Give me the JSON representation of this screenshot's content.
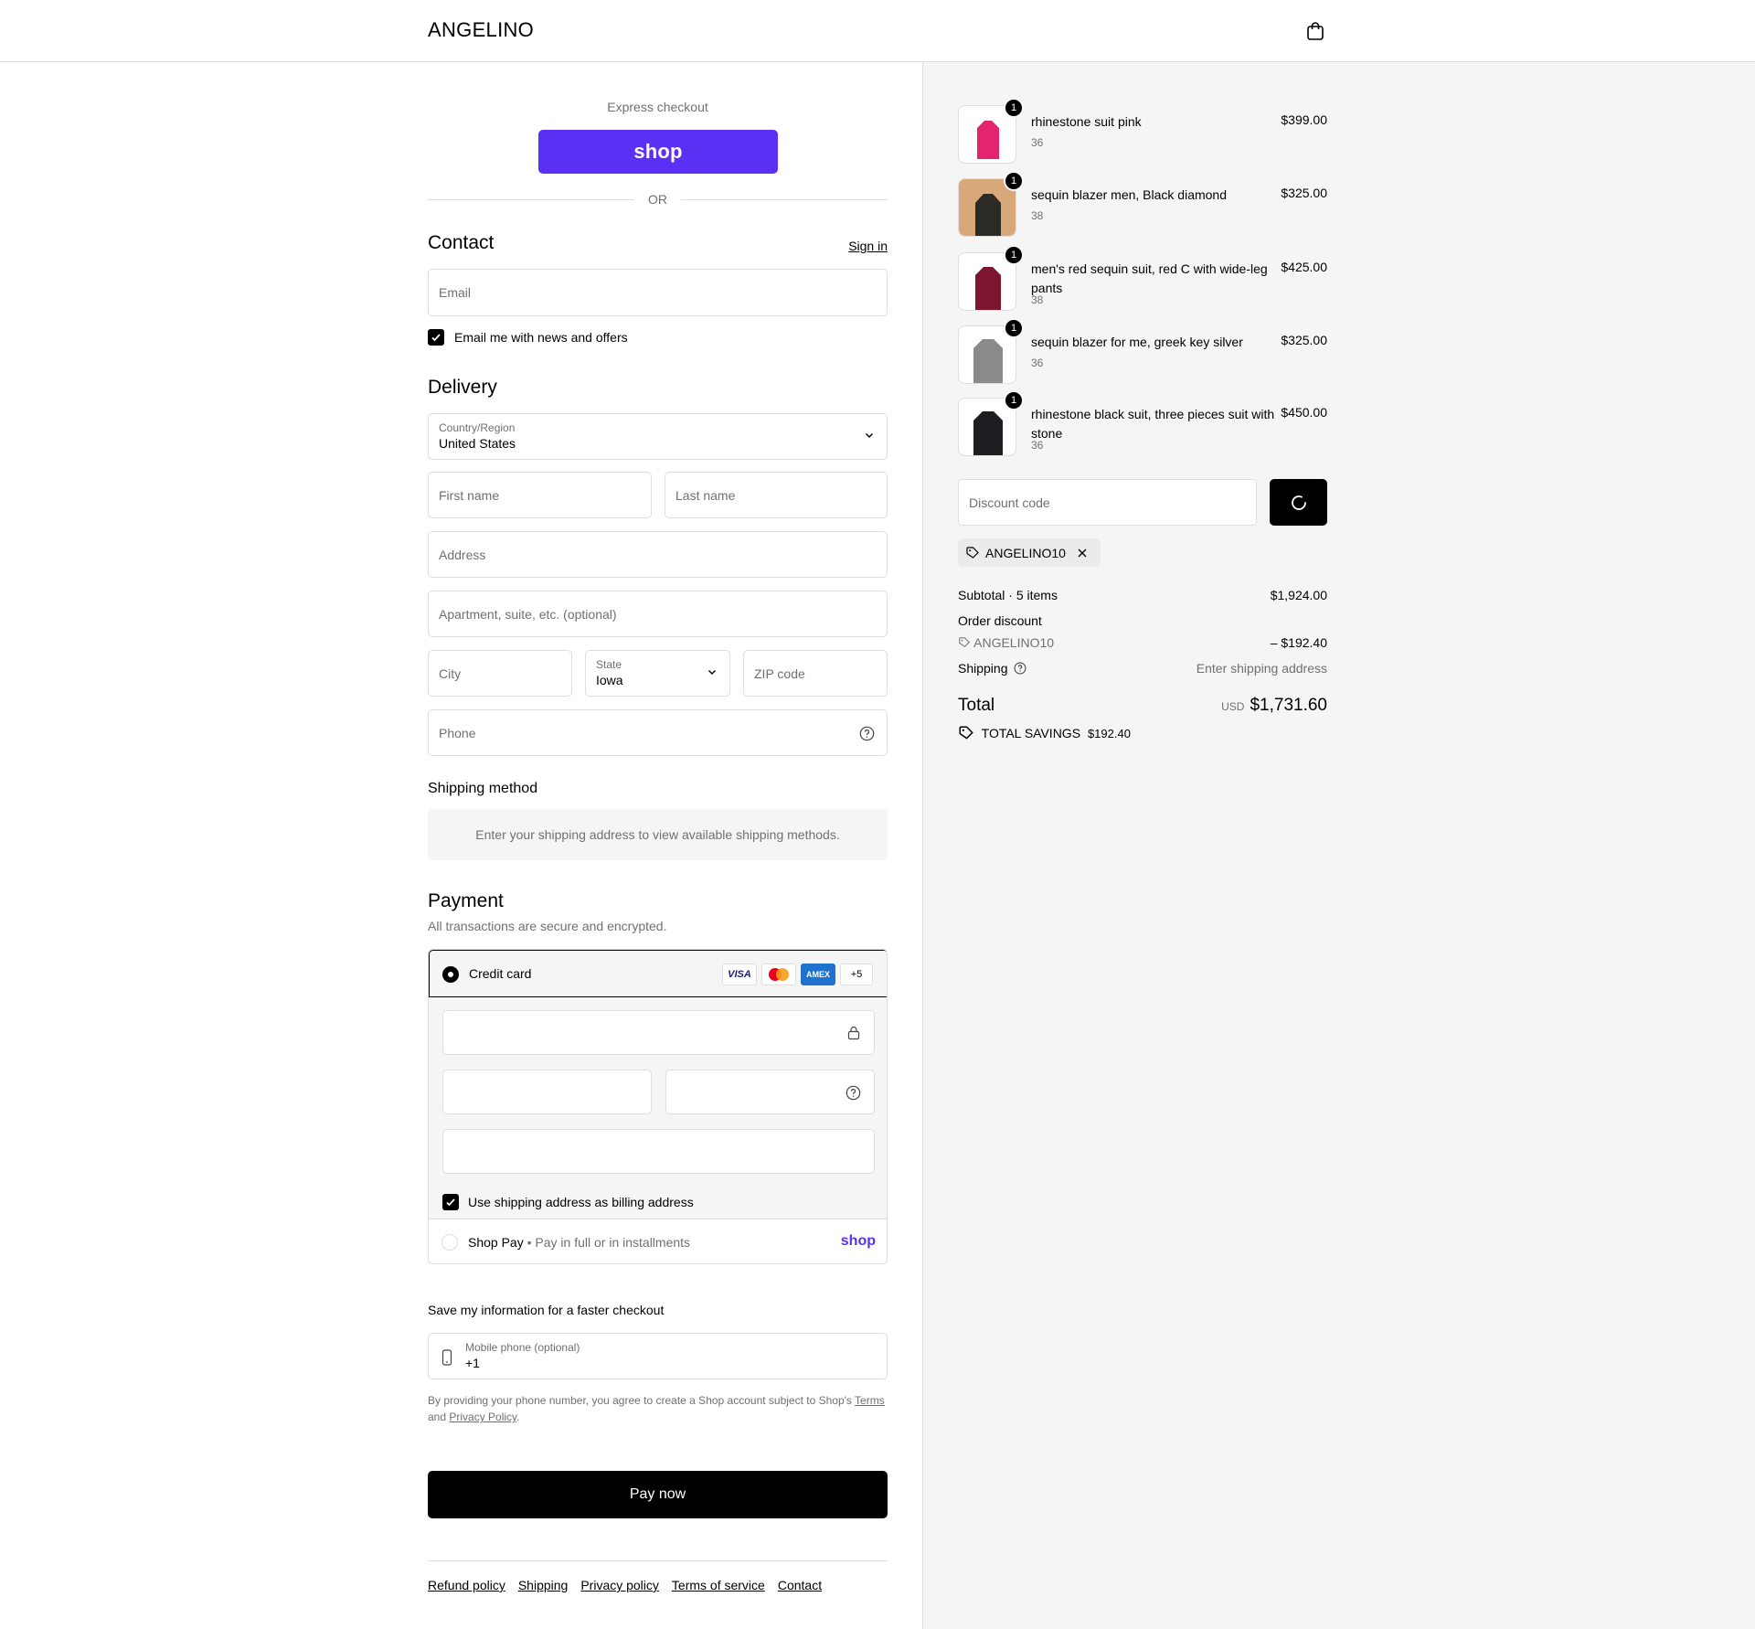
{
  "header": {
    "brand": "ANGELINO",
    "bag_icon": "shopping-bag-icon"
  },
  "express": {
    "label": "Express checkout",
    "shop_button": "shop",
    "or": "OR"
  },
  "contact": {
    "title": "Contact",
    "sign_in": "Sign in",
    "email_placeholder": "Email",
    "newsletter_label": "Email me with news and offers",
    "newsletter_checked": true
  },
  "delivery": {
    "title": "Delivery",
    "country_label": "Country/Region",
    "country_value": "United States",
    "first_name": "First name",
    "last_name": "Last name",
    "address": "Address",
    "apartment": "Apartment, suite, etc. (optional)",
    "city": "City",
    "state_label": "State",
    "state_value": "Iowa",
    "zip": "ZIP code",
    "phone": "Phone"
  },
  "shipping_method": {
    "title": "Shipping method",
    "info": "Enter your shipping address to view available shipping methods."
  },
  "payment": {
    "title": "Payment",
    "subtitle": "All transactions are secure and encrypted.",
    "credit_card": "Credit card",
    "card_logos": [
      "VISA",
      "Mastercard",
      "AMEX"
    ],
    "more_cards": "+5",
    "billing_label": "Use shipping address as billing address",
    "billing_checked": true,
    "shop_pay": "Shop Pay",
    "shop_pay_sub": "Pay in full or in installments",
    "shop_pay_logo": "shop"
  },
  "save_info": {
    "title": "Save my information for a faster checkout",
    "phone_label": "Mobile phone (optional)",
    "phone_value": "+1",
    "legal_prefix": "By providing your phone number, you agree to create a Shop account subject to Shop's ",
    "legal_terms": "Terms",
    "legal_and": "and ",
    "legal_privacy": "Privacy Policy",
    "legal_end": "."
  },
  "pay_now": "Pay now",
  "footer": [
    "Refund policy",
    "Shipping",
    "Privacy policy",
    "Terms of service",
    "Contact"
  ],
  "order": {
    "items": [
      {
        "name": "rhinestone suit pink",
        "size": "36",
        "price": "$399.00",
        "qty": "1",
        "color": "#e3246e"
      },
      {
        "name": "sequin blazer men, Black diamond",
        "size": "38",
        "price": "$325.00",
        "qty": "1",
        "color": "#2b2a24"
      },
      {
        "name": "men's red sequin suit, red C with wide-leg pants",
        "size": "38",
        "price": "$425.00",
        "qty": "1",
        "color": "#7d1530"
      },
      {
        "name": "sequin blazer for me, greek key silver",
        "size": "36",
        "price": "$325.00",
        "qty": "1",
        "color": "#8a8a8a"
      },
      {
        "name": "rhinestone black suit, three pieces suit with stone",
        "size": "36",
        "price": "$450.00",
        "qty": "1",
        "color": "#1e1e22"
      }
    ],
    "discount_placeholder": "Discount code",
    "applied_code": "ANGELINO10",
    "subtotal_label": "Subtotal · 5 items",
    "subtotal_value": "$1,924.00",
    "order_discount_label": "Order discount",
    "discount_code": "ANGELINO10",
    "discount_value": "– $192.40",
    "shipping_label": "Shipping",
    "shipping_value": "Enter shipping address",
    "total_label": "Total",
    "currency": "USD",
    "total_value": "$1,731.60",
    "savings_label": "TOTAL SAVINGS",
    "savings_value": "$192.40"
  }
}
